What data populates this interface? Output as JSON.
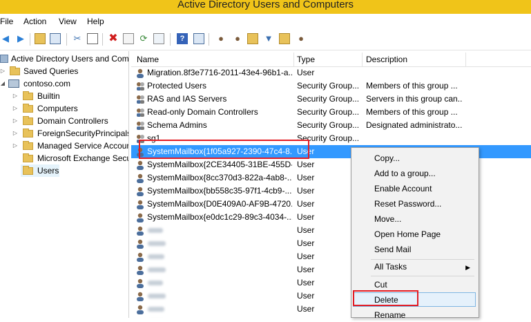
{
  "window": {
    "title": "Active Directory Users and Computers"
  },
  "menu": [
    "File",
    "Action",
    "View",
    "Help"
  ],
  "toolbar_icons": [
    "back-arrow-icon",
    "forward-arrow-icon",
    "up-folder-icon",
    "show-tree-icon",
    "cut-icon",
    "copy-icon",
    "delete-icon",
    "properties-icon",
    "refresh-icon",
    "export-icon",
    "help-icon",
    "console-icon",
    "new-user-icon",
    "new-group-icon",
    "new-ou-icon",
    "filter-icon",
    "find-icon",
    "add-to-group-icon"
  ],
  "tree": {
    "root": "Active Directory Users and Com",
    "saved_queries": "Saved Queries",
    "domain": "contoso.com",
    "children": [
      "Builtin",
      "Computers",
      "Domain Controllers",
      "ForeignSecurityPrincipals",
      "Managed Service Accour",
      "Microsoft Exchange Secu",
      "Users"
    ]
  },
  "columns": {
    "name": "Name",
    "type": "Type",
    "description": "Description"
  },
  "rows": [
    {
      "name": "Migration.8f3e7716-2011-43e4-96b1-a...",
      "type": "User",
      "description": ""
    },
    {
      "name": "Protected Users",
      "type": "Security Group...",
      "description": "Members of this group ..."
    },
    {
      "name": "RAS and IAS Servers",
      "type": "Security Group...",
      "description": "Servers in this group can..."
    },
    {
      "name": "Read-only Domain Controllers",
      "type": "Security Group...",
      "description": "Members of this group ..."
    },
    {
      "name": "Schema Admins",
      "type": "Security Group...",
      "description": "Designated administrato..."
    },
    {
      "name": "sg1",
      "type": "Security Group...",
      "description": ""
    },
    {
      "name": "SystemMailbox{1f05a927-2390-47c4-8...",
      "type": "User",
      "description": ""
    },
    {
      "name": "SystemMailbox{2CE34405-31BE-455D-...",
      "type": "User",
      "description": ""
    },
    {
      "name": "SystemMailbox{8cc370d3-822a-4ab8-...",
      "type": "User",
      "description": ""
    },
    {
      "name": "SystemMailbox{bb558c35-97f1-4cb9-...",
      "type": "User",
      "description": ""
    },
    {
      "name": "SystemMailbox{D0E409A0-AF9B-4720...",
      "type": "User",
      "description": ""
    },
    {
      "name": "SystemMailbox{e0dc1c29-89c3-4034-...",
      "type": "User",
      "description": ""
    },
    {
      "name": "",
      "type": "User",
      "description": ""
    },
    {
      "name": "",
      "type": "User",
      "description": ""
    },
    {
      "name": "",
      "type": "User",
      "description": ""
    },
    {
      "name": "",
      "type": "User",
      "description": ""
    },
    {
      "name": "",
      "type": "User",
      "description": ""
    },
    {
      "name": "",
      "type": "User",
      "description": ""
    },
    {
      "name": "",
      "type": "User",
      "description": ""
    },
    {
      "name": "",
      "type": "User",
      "description": ""
    }
  ],
  "context_menu": {
    "items": [
      "Copy...",
      "Add to a group...",
      "Enable Account",
      "Reset Password...",
      "Move...",
      "Open Home Page",
      "Send Mail",
      "All Tasks",
      "Cut",
      "Delete",
      "Rename"
    ]
  },
  "colors": {
    "title_bar": "#f0c419",
    "selection": "#3399ff",
    "highlight_box": "#e21b23"
  }
}
